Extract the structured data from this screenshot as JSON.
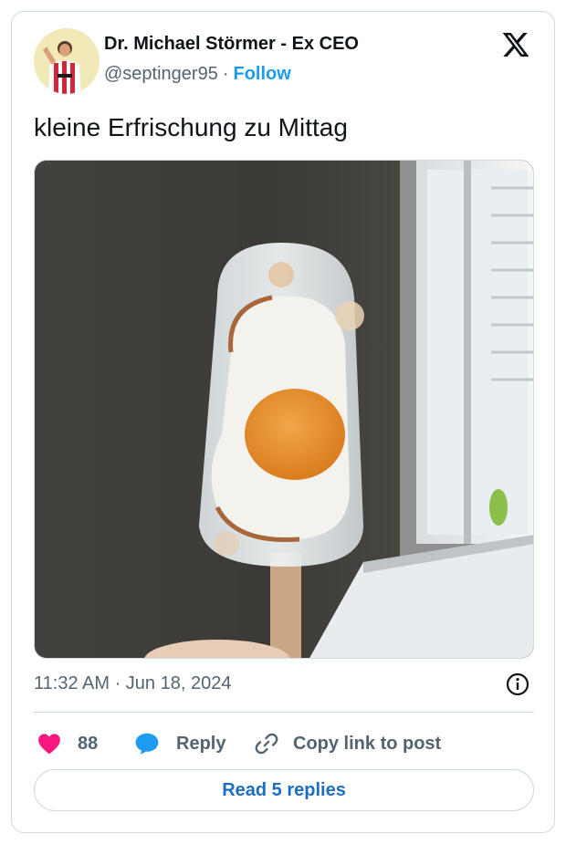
{
  "author": {
    "name": "Dr. Michael Störmer - Ex CEO",
    "handle": "@septinger95",
    "separator": "·",
    "follow_label": "Follow"
  },
  "tweet": {
    "text": "kleine Erfrischung zu Mittag",
    "timestamp": "11:32 AM · Jun 18, 2024"
  },
  "actions": {
    "like_count": "88",
    "reply_label": "Reply",
    "copy_link_label": "Copy link to post"
  },
  "footer": {
    "read_replies_label": "Read 5 replies"
  },
  "icons": {
    "like": "heart-icon",
    "reply": "speech-bubble-icon",
    "copy": "link-icon",
    "info": "info-icon",
    "brand": "x-logo-icon"
  },
  "colors": {
    "accent": "#1d9bf0",
    "like": "#f91880",
    "muted": "#536471",
    "border": "#cfd9de"
  }
}
